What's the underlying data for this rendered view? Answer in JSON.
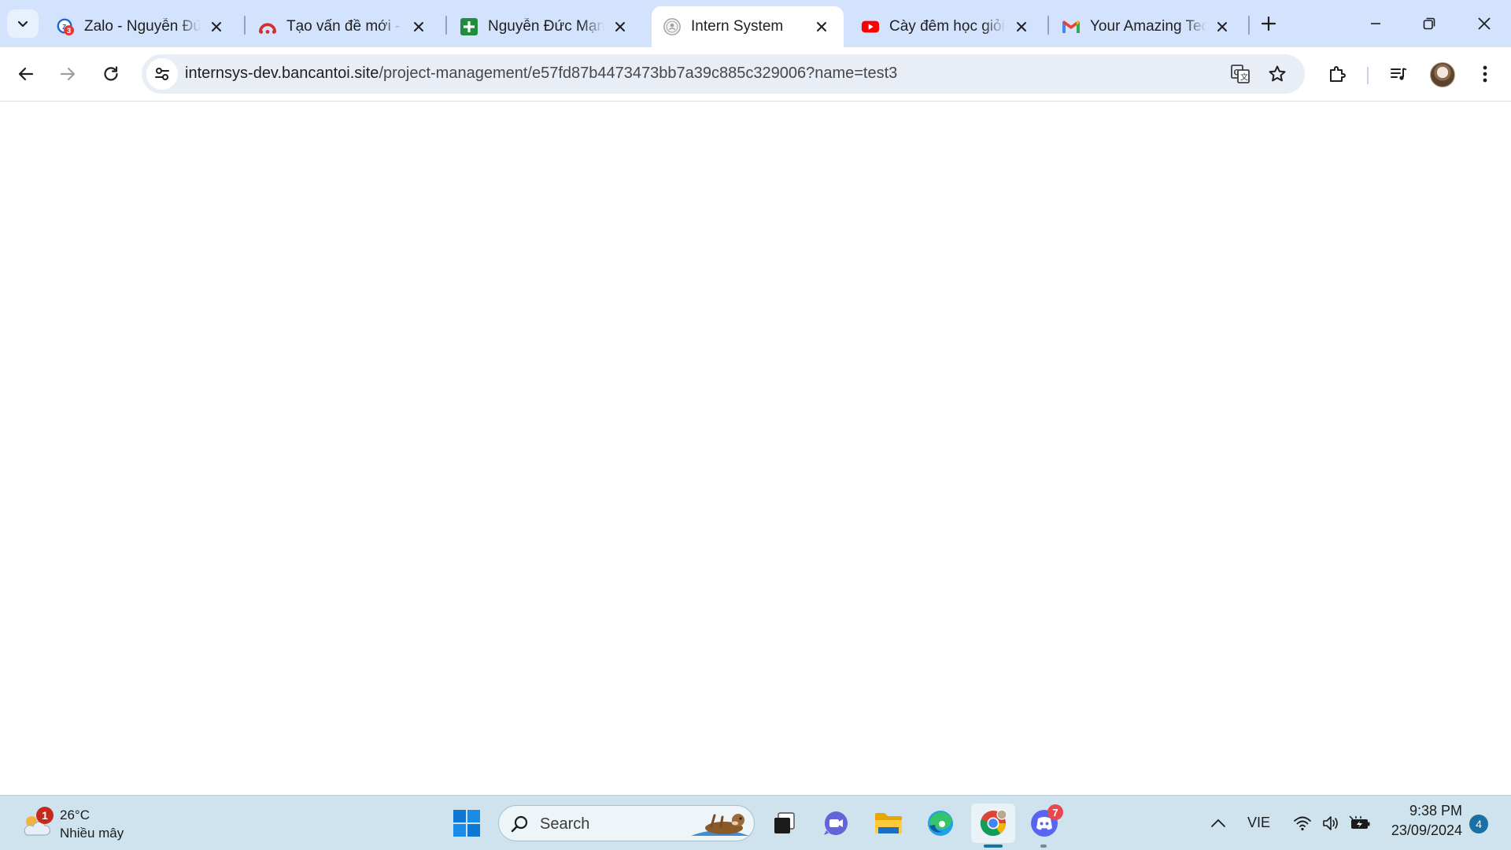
{
  "browser": {
    "tabs": [
      {
        "title": "Zalo - Nguyễn Đức",
        "icon": "zalo-icon",
        "badge": "3",
        "active": false
      },
      {
        "title": "Tạo vấn đề mới - A",
        "icon": "arch-icon",
        "active": false
      },
      {
        "title": "Nguyễn Đức Mạnh",
        "icon": "sheets-plus-icon",
        "active": false
      },
      {
        "title": "Intern System",
        "icon": "seal-icon",
        "active": true
      },
      {
        "title": "Cày đêm học giỏi",
        "icon": "youtube-icon",
        "active": false
      },
      {
        "title": "Your Amazing Tech",
        "icon": "gmail-icon",
        "active": false
      }
    ],
    "address": {
      "domain": "internsys-dev.bancantoi.site",
      "path": "/project-management/e57fd87b4473473bb7a39c885c329006?name=test3"
    }
  },
  "taskbar": {
    "weather": {
      "badge": "1",
      "temperature": "26°C",
      "condition": "Nhiều mây"
    },
    "search_placeholder": "Search",
    "discord_badge": "7",
    "language": "VIE",
    "time": "9:38 PM",
    "date": "23/09/2024",
    "notification_count": "4"
  },
  "colors": {
    "tabstrip": "#d3e3fd",
    "omnibox": "#e9eef6",
    "taskbar": "#cfe3ee",
    "active_indicator": "#1a6fa5"
  }
}
